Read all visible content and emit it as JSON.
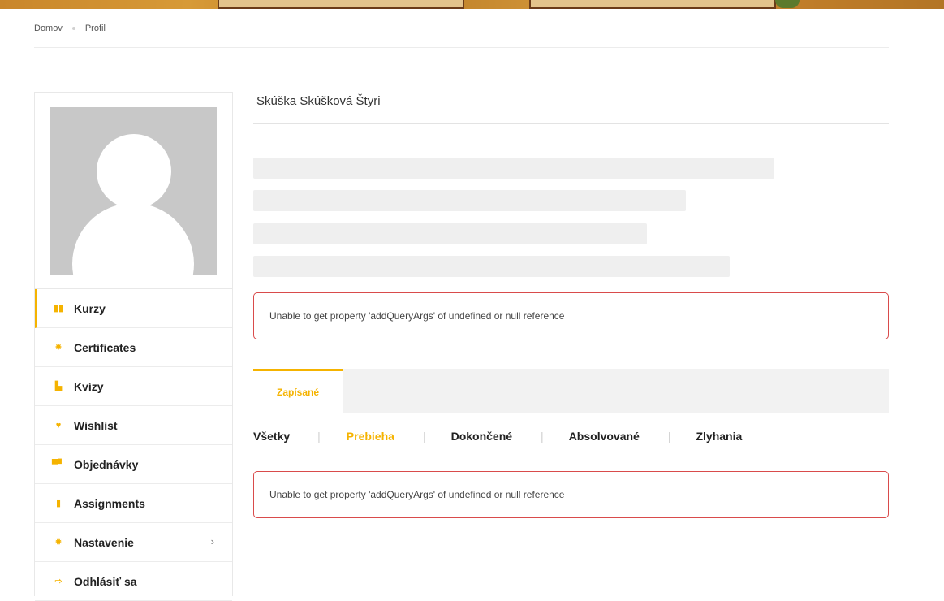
{
  "breadcrumb": {
    "home": "Domov",
    "current": "Profil"
  },
  "profile": {
    "name": "Skúška Skúšková Štyri"
  },
  "sidebar": {
    "items": [
      {
        "label": "Kurzy",
        "icon": "book-icon",
        "glyph": "▮▮"
      },
      {
        "label": "Certificates",
        "icon": "certificate-icon",
        "glyph": "✸"
      },
      {
        "label": "Kvízy",
        "icon": "puzzle-icon",
        "glyph": "▙"
      },
      {
        "label": "Wishlist",
        "icon": "heart-icon",
        "glyph": "♥"
      },
      {
        "label": "Objednávky",
        "icon": "cart-icon",
        "glyph": "▀▘"
      },
      {
        "label": "Assignments",
        "icon": "file-icon",
        "glyph": "▮"
      },
      {
        "label": "Nastavenie",
        "icon": "gear-icon",
        "glyph": "✹"
      },
      {
        "label": "Odhlásiť sa",
        "icon": "sign-out-icon",
        "glyph": "⇨"
      }
    ],
    "chevron": "›"
  },
  "errors": {
    "first": "Unable to get property 'addQueryArgs' of undefined or null reference",
    "second": "Unable to get property 'addQueryArgs' of undefined or null reference"
  },
  "tabs": {
    "active": "Zapísané"
  },
  "filters": {
    "items": [
      "Všetky",
      "Prebieha",
      "Dokončené",
      "Absolvované",
      "Zlyhania"
    ],
    "active_index": 1,
    "divider": "|"
  },
  "colors": {
    "accent": "#f5b300",
    "error_border": "#d94b4b",
    "skeleton": "#efefef"
  }
}
